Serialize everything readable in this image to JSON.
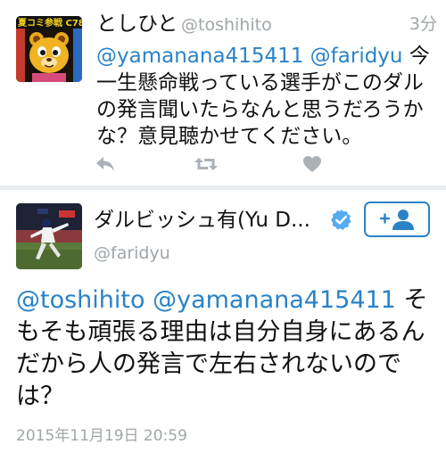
{
  "reply_tweet": {
    "display_name": "としひと",
    "handle": "@toshihito",
    "time_ago": "3分",
    "mention_1": "@yamanana415411",
    "mention_2": "@faridyu",
    "text_rest": " 今一生懸命戦っている選手がこのダルの発言聞いたらなんと思うだろうかな？意見聴かせてください。",
    "avatar_badge": "夏コミ参戦 C78",
    "actions": {
      "reply_icon": "reply-arrow-icon",
      "retweet_icon": "retweet-icon",
      "like_icon": "heart-icon"
    }
  },
  "main_tweet": {
    "display_name": "ダルビッシュ有(Yu D...",
    "handle": "@faridyu",
    "verified_icon": "verified-badge-icon",
    "follow_icon": "add-user-icon",
    "mention_1": "@toshihito",
    "mention_2": "@yamanana415411",
    "text_rest": " そもそも頑張る理由は自分自身にあるんだから人の発言で左右されないのでは？",
    "timestamp": "2015年11月19日 20:59"
  },
  "colors": {
    "accent": "#2a83c7",
    "muted": "#a0a6ab",
    "divider": "#e9edf0",
    "verified": "#55acee"
  }
}
